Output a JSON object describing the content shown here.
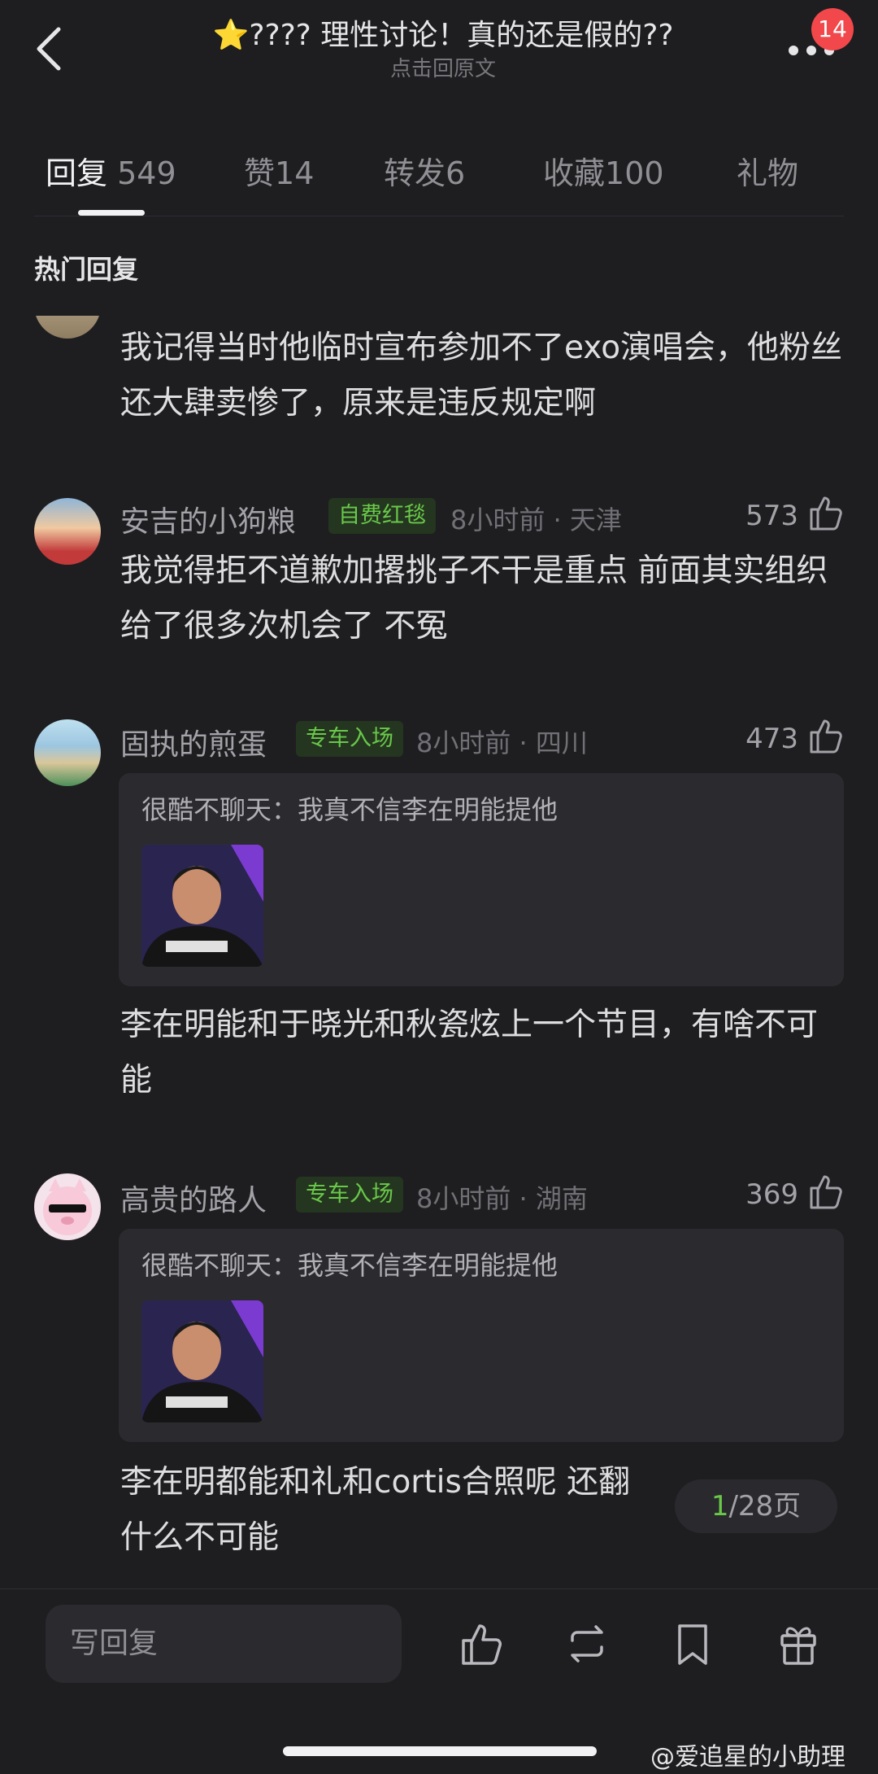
{
  "header": {
    "title": "⭐️???? 理性讨论！真的还是假的??",
    "subtitle": "点击回原文",
    "badge_count": "14"
  },
  "tabs": [
    {
      "label": "回复",
      "count": "549"
    },
    {
      "label": "赞",
      "count": "14"
    },
    {
      "label": "转发",
      "count": "6"
    },
    {
      "label": "收藏",
      "count": "100"
    },
    {
      "label": "礼物",
      "count": ""
    }
  ],
  "section_title": "热门回复",
  "comments": [
    {
      "text": "我记得当时他临时宣布参加不了exo演唱会，他粉丝还大肆卖惨了，原来是违反规定啊"
    },
    {
      "username": "安吉的小狗粮",
      "tag": "自费红毯",
      "meta": "8小时前 · 天津",
      "likes": "573",
      "text": "我觉得拒不道歉加撂挑子不干是重点 前面其实组织给了很多次机会了 不冤"
    },
    {
      "username": "固执的煎蛋",
      "tag": "专车入场",
      "meta": "8小时前 · 四川",
      "likes": "473",
      "quote": "很酷不聊天：我真不信李在明能提他",
      "text": "李在明能和于晓光和秋瓷炫上一个节目，有啥不可能"
    },
    {
      "username": "高贵的路人",
      "tag": "专车入场",
      "meta": "8小时前 · 湖南",
      "likes": "369",
      "quote": "很酷不聊天：我真不信李在明能提他",
      "text": "李在明都能和礼和cortis合照呢 还翻",
      "text2": "什么不可能"
    }
  ],
  "pager": {
    "current": "1",
    "rest": "/28页"
  },
  "bottom_bar": {
    "input_placeholder": "写回复"
  },
  "watermark": "@爱追星的小助理",
  "colors": {
    "background": "#1e1e21",
    "tag_green": "#69c84a",
    "badge_red": "#f2484c"
  }
}
